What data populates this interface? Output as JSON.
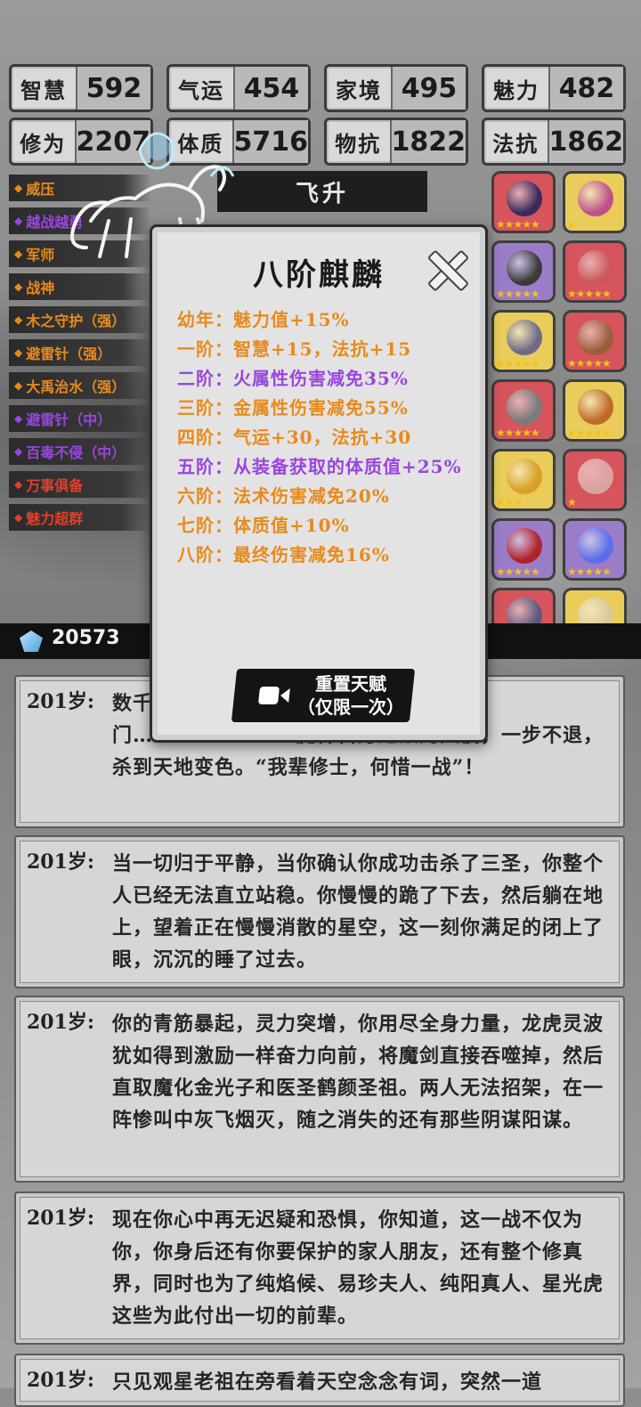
{
  "stats": [
    {
      "label": "智慧",
      "value": "592"
    },
    {
      "label": "气运",
      "value": "454"
    },
    {
      "label": "家境",
      "value": "495"
    },
    {
      "label": "魅力",
      "value": "482"
    },
    {
      "label": "修为",
      "value": "2207"
    },
    {
      "label": "体质",
      "value": "5716"
    },
    {
      "label": "物抗",
      "value": "1822"
    },
    {
      "label": "法抗",
      "value": "1862"
    }
  ],
  "talents": [
    {
      "label": "威压",
      "color": "#e88a1b"
    },
    {
      "label": "越战越勇",
      "color": "#9a45e0"
    },
    {
      "label": "军师",
      "color": "#e88a1b"
    },
    {
      "label": "战神",
      "color": "#e88a1b"
    },
    {
      "label": "木之守护（强）",
      "color": "#e88a1b"
    },
    {
      "label": "避雷针（强）",
      "color": "#e88a1b"
    },
    {
      "label": "大禹治水（强）",
      "color": "#e88a1b"
    },
    {
      "label": "避雷针（中）",
      "color": "#9a45e0"
    },
    {
      "label": "百毒不侵（中）",
      "color": "#9a45e0"
    },
    {
      "label": "万事俱备",
      "color": "#e0402a"
    },
    {
      "label": "魅力超群",
      "color": "#e0402a"
    }
  ],
  "ascend_label": "飞升",
  "equipment": [
    {
      "bg": "#d6545c",
      "gem": "#3b2a5c",
      "stars": "★★★★★"
    },
    {
      "bg": "#e9cc5a",
      "gem": "#c0508c",
      "stars": "★"
    },
    {
      "bg": "#9b7cc9",
      "gem": "#3a3a3a",
      "stars": "★★★★★"
    },
    {
      "bg": "#d6545c",
      "gem": "#c9575d",
      "stars": "★★★★★"
    },
    {
      "bg": "#e9cc5a",
      "gem": "#6e6a85",
      "stars": "★★★★★"
    },
    {
      "bg": "#d6545c",
      "gem": "#9b5f38",
      "stars": "★★★★★"
    },
    {
      "bg": "#d6545c",
      "gem": "#7a7a7a",
      "stars": "★★★★★"
    },
    {
      "bg": "#e9cc5a",
      "gem": "#c06a2a",
      "stars": "★★★★★"
    },
    {
      "bg": "#e9cc5a",
      "gem": "#d9a022",
      "stars": "★★★"
    },
    {
      "bg": "#d6545c",
      "gem": "#d9a3a0",
      "stars": "★"
    },
    {
      "bg": "#9b7cc9",
      "gem": "#b0222a",
      "stars": "★★★★★"
    },
    {
      "bg": "#9b7cc9",
      "gem": "#5a6ee8",
      "stars": "★★★★★"
    },
    {
      "bg": "#d6545c",
      "gem": "#5a5a80",
      "stars": "★★★★★"
    },
    {
      "bg": "#e9cc5a",
      "gem": "#d9c79a",
      "stars": "★★★★★"
    }
  ],
  "resource_value": "20573",
  "modal": {
    "title": "八阶麒麟",
    "stages": [
      {
        "text": "幼年：魅力值+15%",
        "color": "orange"
      },
      {
        "text": "一阶：智慧+15，法抗+15",
        "color": "orange"
      },
      {
        "text": "二阶：火属性伤害减免35%",
        "color": "purple"
      },
      {
        "text": "三阶：金属性伤害减免55%",
        "color": "orange"
      },
      {
        "text": "四阶：气运+30，法抗+30",
        "color": "orange"
      },
      {
        "text": "五阶：从装备获取的体质值+25%",
        "color": "purple"
      },
      {
        "text": "六阶：法术伤害减免20%",
        "color": "orange"
      },
      {
        "text": "七阶：体质值+10%",
        "color": "orange"
      },
      {
        "text": "八阶：最终伤害减免16%",
        "color": "orange"
      }
    ],
    "reset_line1": "重置天赋",
    "reset_line2": "（仅限一次）"
  },
  "logs": [
    {
      "age": "201岁:",
      "text": "数千…………………………有人在时空之门……………………魔界百万之众的入侵，一步不退，杀到天地变色。“我辈修士，何惜一战”！"
    },
    {
      "age": "201岁:",
      "text": "当一切归于平静，当你确认你成功击杀了三圣，你整个人已经无法直立站稳。你慢慢的跪了下去，然后躺在地上，望着正在慢慢消散的星空，这一刻你满足的闭上了眼，沉沉的睡了过去。"
    },
    {
      "age": "201岁:",
      "text": "你的青筋暴起，灵力突增，你用尽全身力量，龙虎灵波犹如得到激励一样奋力向前，将魔剑直接吞噬掉，然后直取魔化金光子和医圣鹤颜圣祖。两人无法招架，在一阵惨叫中灰飞烟灭，随之消失的还有那些阴谋阳谋。"
    },
    {
      "age": "201岁:",
      "text": "现在你心中再无迟疑和恐惧，你知道，这一战不仅为你，你身后还有你要保护的家人朋友，还有整个修真界，同时也为了纯焰候、易珍夫人、纯阳真人、星光虎这些为此付出一切的前辈。"
    },
    {
      "age": "201岁:",
      "text": "只见观星老祖在旁看着天空念念有词，突然一道"
    }
  ]
}
